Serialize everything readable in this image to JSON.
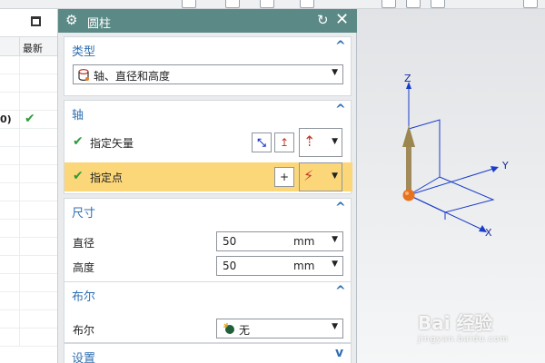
{
  "dialog": {
    "title": "圆柱",
    "sections": {
      "type": {
        "label": "类型",
        "dropdown": "轴、直径和高度"
      },
      "axis": {
        "label": "轴",
        "specify_vector": "指定矢量",
        "specify_point": "指定点"
      },
      "size": {
        "label": "尺寸",
        "diameter_label": "直径",
        "diameter_value": "50",
        "diameter_unit": "mm",
        "height_label": "高度",
        "height_value": "50",
        "height_unit": "mm"
      },
      "boolean": {
        "label": "布尔",
        "row_label": "布尔",
        "value": "无"
      },
      "settings": {
        "label": "设置"
      }
    }
  },
  "navigator": {
    "column_latest": "最新",
    "row_partial_text": "0)"
  },
  "viewport": {
    "axis_x": "X",
    "axis_y": "Y",
    "axis_z": "Z"
  },
  "watermark": {
    "main": "Bai 经验",
    "sub": "jingyan.baidu.com"
  },
  "colors": {
    "title_bar": "#5b8a86",
    "section_label": "#2f6fb2",
    "highlight": "#fcd779",
    "check": "#2a9d3a"
  }
}
